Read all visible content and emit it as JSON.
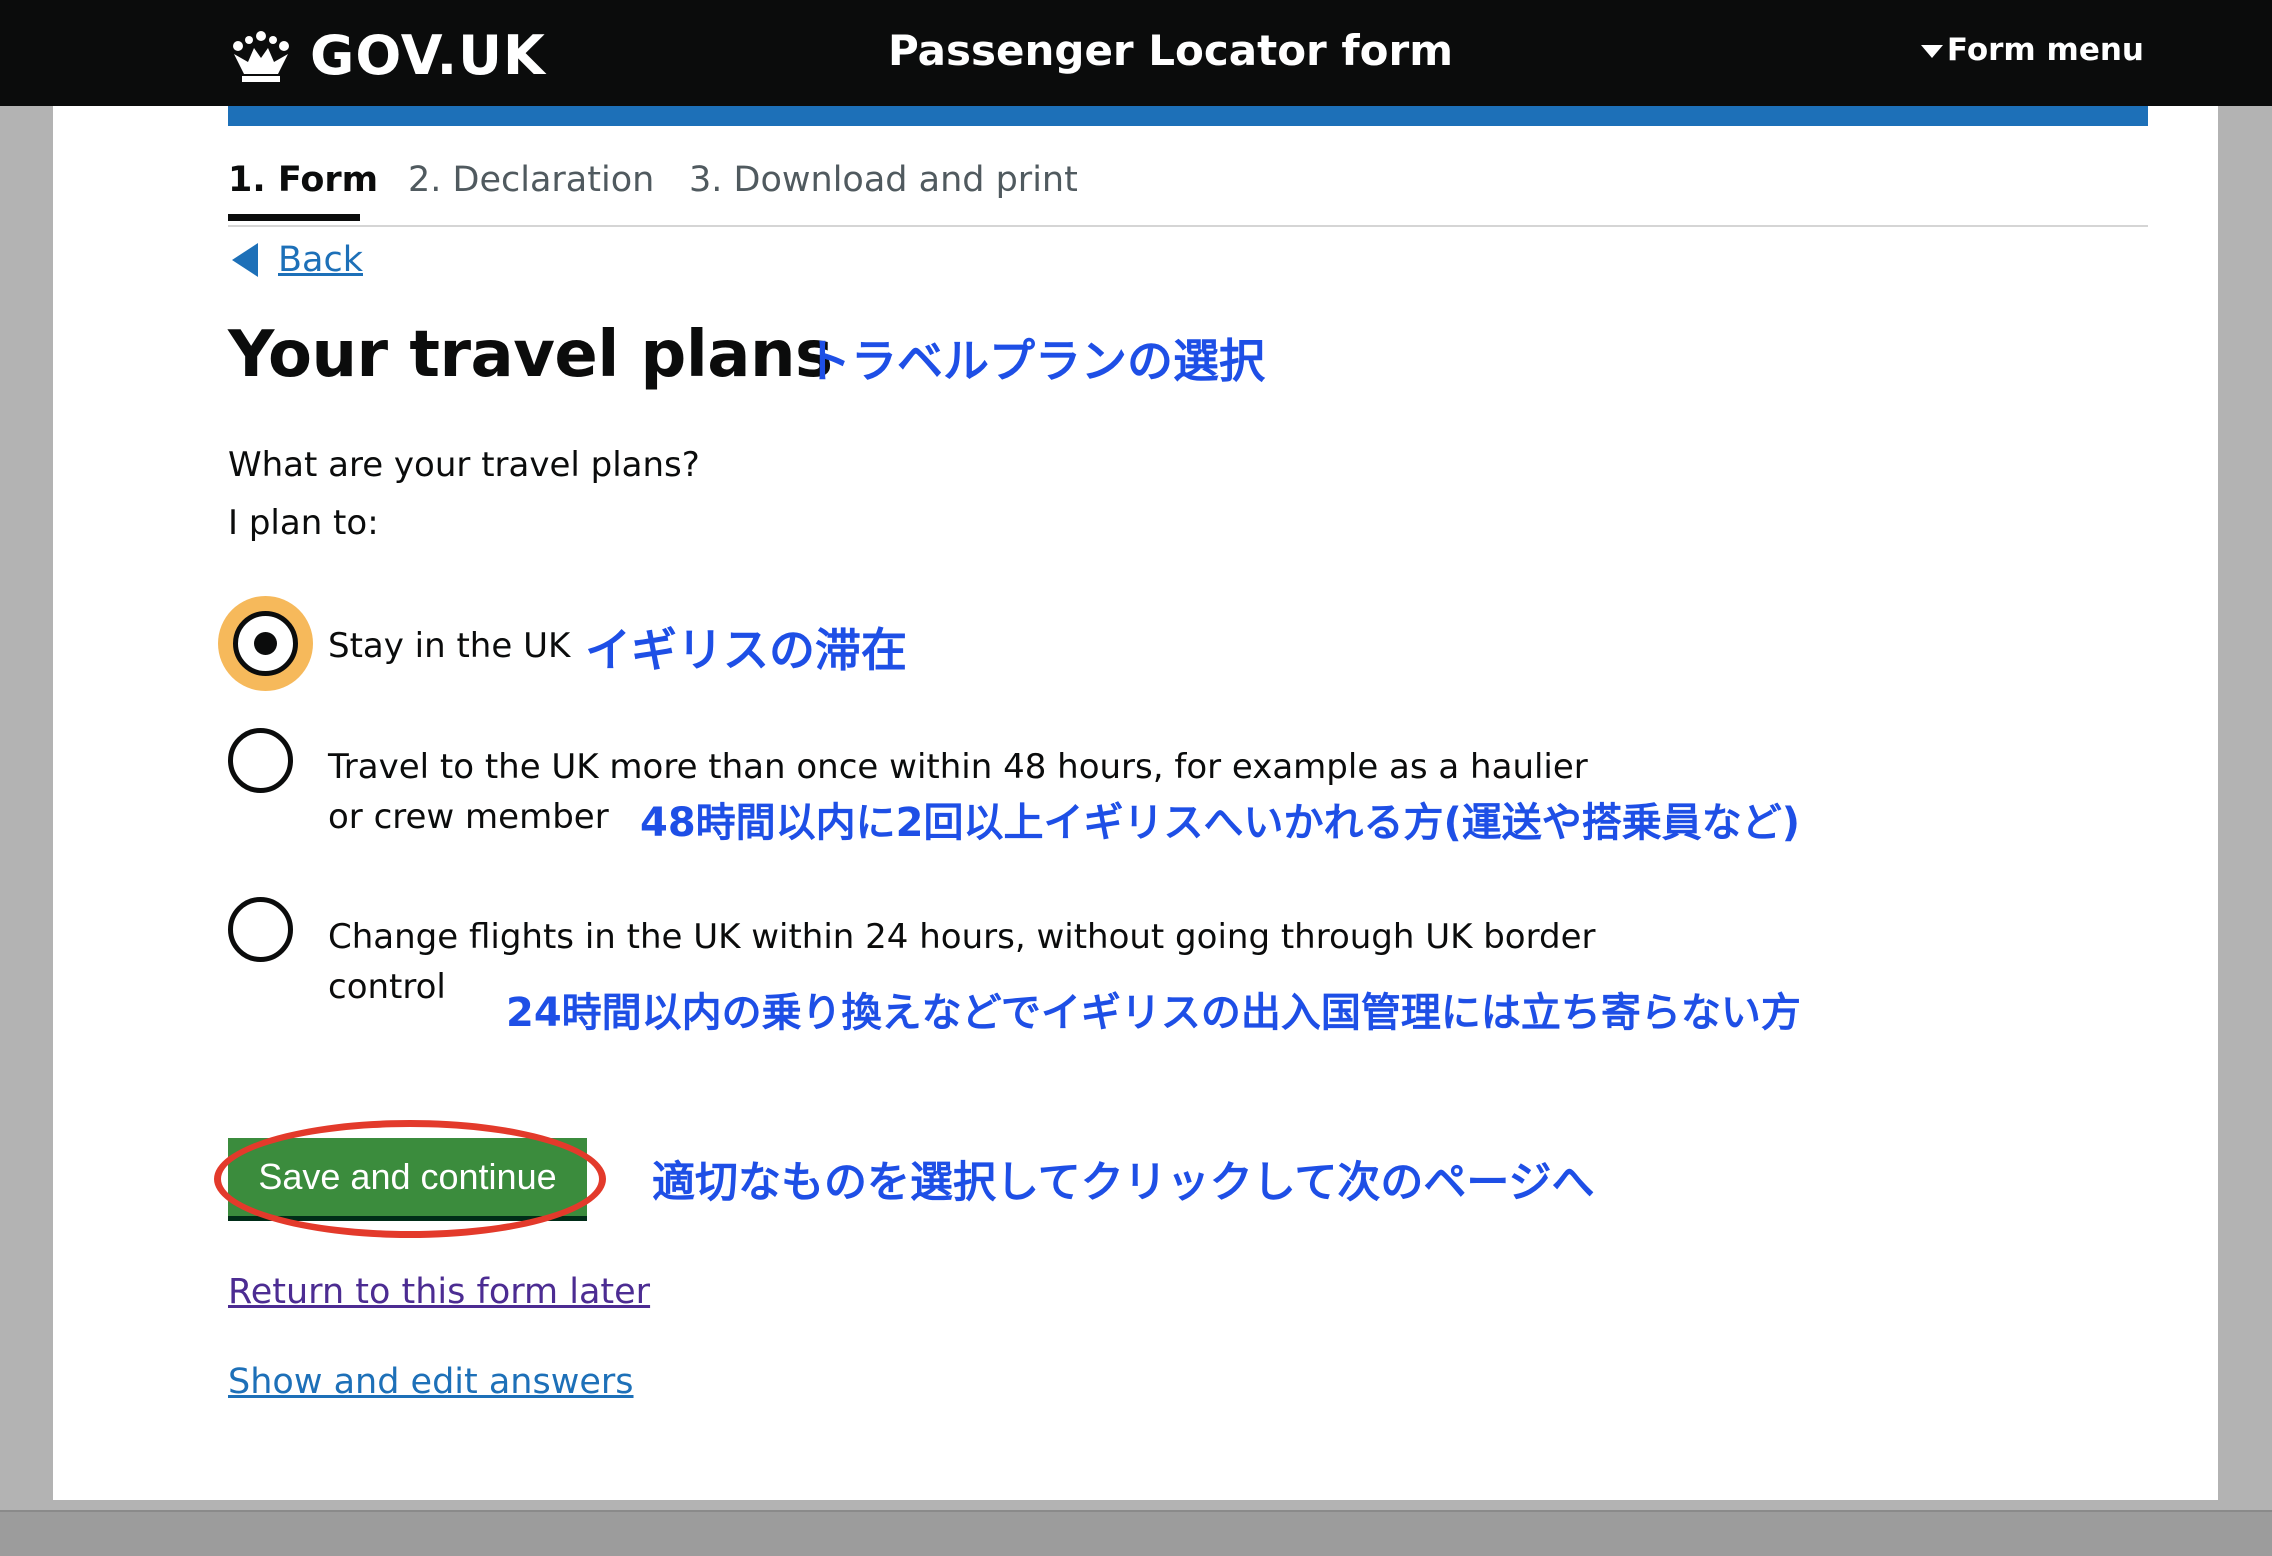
{
  "header": {
    "logo_text": "GOV.UK",
    "logo_icon": "crown-icon",
    "service_name": "Passenger Locator form",
    "menu_label": "Form menu"
  },
  "steps": [
    {
      "label": "1. Form",
      "active": true
    },
    {
      "label": "2. Declaration",
      "active": false
    },
    {
      "label": "3. Download and print",
      "active": false
    }
  ],
  "back_label": "Back",
  "page_title": "Your travel plans",
  "question": "What are your travel plans?",
  "lead_in": "I plan to:",
  "options": [
    {
      "line1": "Stay in the UK",
      "line2": "",
      "selected": true
    },
    {
      "line1": "Travel to the UK more than once within 48 hours, for example as a haulier",
      "line2": "or crew member",
      "selected": false
    },
    {
      "line1": "Change flights in the UK within 24 hours, without going through UK border",
      "line2": "control",
      "selected": false
    }
  ],
  "save_button": "Save and continue",
  "return_link": "Return to this form later",
  "show_link": "Show and edit answers",
  "annotations": {
    "title_note": "トラベルプランの選択",
    "option1_note": "イギリスの滞在",
    "option2_note": "48時間以内に2回以上イギリスへいかれる方(運送や搭乗員など)",
    "option3_note": "24時間以内の乗り換えなどでイギリスの出入国管理には立ち寄らない方",
    "button_note": "適切なものを選択してクリックして次のページへ"
  },
  "colors": {
    "header_bg": "#0b0c0c",
    "brand_blue": "#1d70b8",
    "button_green": "#3b8c3d",
    "annotation_blue": "#1e4fe6",
    "highlight_red": "#e33a2b",
    "focus_yellow": "#f6b95b"
  }
}
